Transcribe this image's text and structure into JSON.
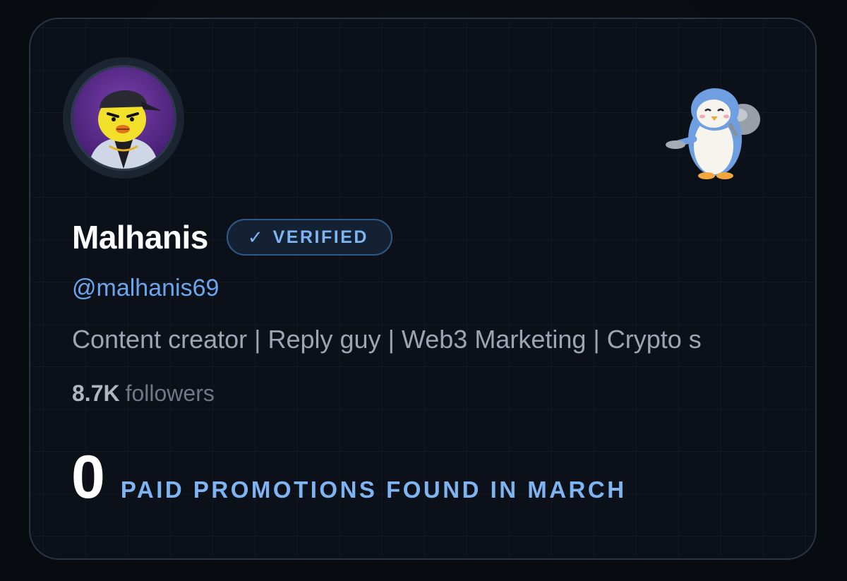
{
  "profile": {
    "name": "Malhanis",
    "verified_label": "VERIFIED",
    "verified_icon": "checkmark-icon",
    "handle": "@malhanis69",
    "bio": "Content creator | Reply guy | Web3 Marketing | Crypto s",
    "followers_count": "8.7K",
    "followers_label": "followers",
    "avatar_icon": "chick-with-cap-avatar",
    "mascot_icon": "penguin-mascot-icon"
  },
  "promotions": {
    "count": "0",
    "label": "PAID PROMOTIONS FOUND IN MARCH"
  },
  "colors": {
    "accent": "#7fb4f2",
    "handle": "#6aa6ee",
    "background": "#0c1119",
    "border": "#2a3444"
  }
}
